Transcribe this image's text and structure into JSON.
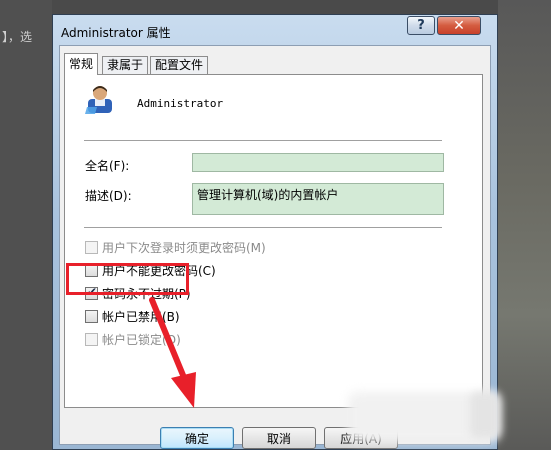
{
  "background": {
    "fragment_text": "】，选"
  },
  "window": {
    "title": "Administrator 属性",
    "help_label": "?",
    "close_label": "✕"
  },
  "tabs": [
    {
      "label": "常规",
      "active": true
    },
    {
      "label": "隶属于",
      "active": false
    },
    {
      "label": "配置文件",
      "active": false
    }
  ],
  "user": {
    "name": "Administrator",
    "icon": "user-icon"
  },
  "fields": {
    "fullname_label": "全名(F):",
    "fullname_value": "",
    "description_label": "描述(D):",
    "description_value": "管理计算机(域)的内置帐户"
  },
  "checkboxes": [
    {
      "label": "用户下次登录时须更改密码(M)",
      "checked": false,
      "enabled": false
    },
    {
      "label": "用户不能更改密码(C)",
      "checked": false,
      "enabled": true
    },
    {
      "label": "密码永不过期(P)",
      "checked": true,
      "enabled": true
    },
    {
      "label": "帐户已禁用(B)",
      "checked": false,
      "enabled": true
    },
    {
      "label": "帐户已锁定(O)",
      "checked": false,
      "enabled": false
    }
  ],
  "buttons": {
    "ok": "确定",
    "cancel": "取消",
    "apply": "应用(A)"
  },
  "annotation": {
    "color": "#e8202a"
  }
}
